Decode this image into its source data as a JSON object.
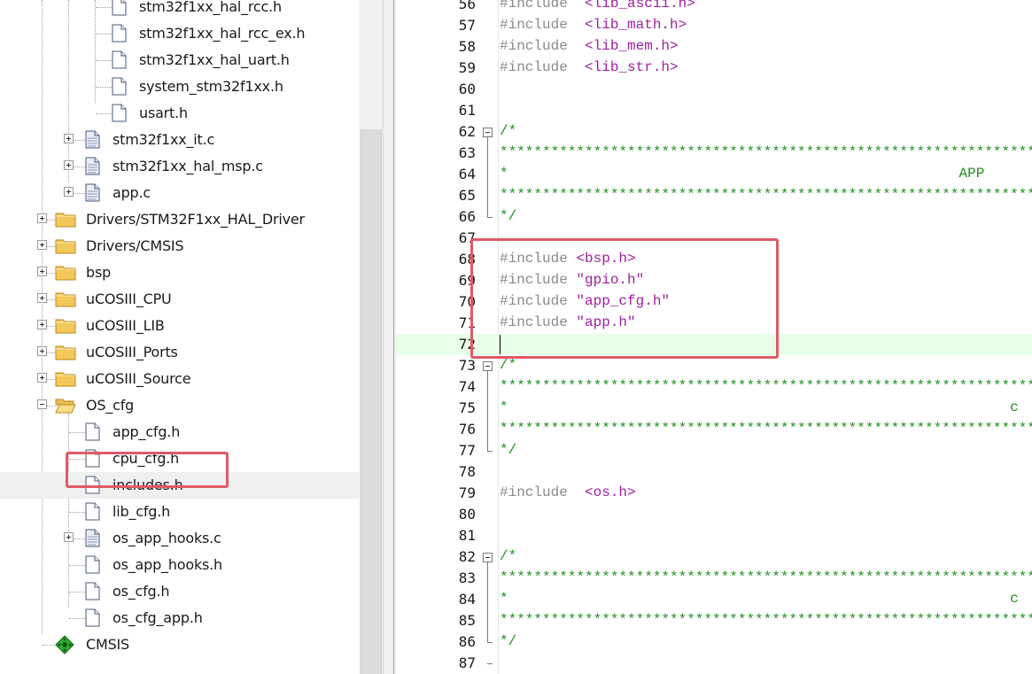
{
  "tree": {
    "items": [
      {
        "label": "stm32f1xx_hal_rcc.h",
        "kind": "h",
        "level": 3
      },
      {
        "label": "stm32f1xx_hal_rcc_ex.h",
        "kind": "h",
        "level": 3
      },
      {
        "label": "stm32f1xx_hal_uart.h",
        "kind": "h",
        "level": 3
      },
      {
        "label": "system_stm32f1xx.h",
        "kind": "h",
        "level": 3
      },
      {
        "label": "usart.h",
        "kind": "h",
        "level": 3
      },
      {
        "label": "stm32f1xx_it.c",
        "kind": "c",
        "level": 2,
        "expand": "plus"
      },
      {
        "label": "stm32f1xx_hal_msp.c",
        "kind": "c",
        "level": 2,
        "expand": "plus"
      },
      {
        "label": "app.c",
        "kind": "c",
        "level": 2,
        "expand": "plus"
      },
      {
        "label": "Drivers/STM32F1xx_HAL_Driver",
        "kind": "folder",
        "level": 1,
        "expand": "plus"
      },
      {
        "label": "Drivers/CMSIS",
        "kind": "folder",
        "level": 1,
        "expand": "plus"
      },
      {
        "label": "bsp",
        "kind": "folder",
        "level": 1,
        "expand": "plus"
      },
      {
        "label": "uCOSIII_CPU",
        "kind": "folder",
        "level": 1,
        "expand": "plus"
      },
      {
        "label": "uCOSIII_LIB",
        "kind": "folder",
        "level": 1,
        "expand": "plus"
      },
      {
        "label": "uCOSIII_Ports",
        "kind": "folder",
        "level": 1,
        "expand": "plus"
      },
      {
        "label": "uCOSIII_Source",
        "kind": "folder",
        "level": 1,
        "expand": "plus"
      },
      {
        "label": "OS_cfg",
        "kind": "folder-open",
        "level": 1,
        "expand": "minus"
      },
      {
        "label": "app_cfg.h",
        "kind": "h",
        "level": 2
      },
      {
        "label": "cpu_cfg.h",
        "kind": "h",
        "level": 2
      },
      {
        "label": "includes.h",
        "kind": "h",
        "level": 2,
        "selected": true
      },
      {
        "label": "lib_cfg.h",
        "kind": "h",
        "level": 2
      },
      {
        "label": "os_app_hooks.c",
        "kind": "c",
        "level": 2,
        "expand": "plus"
      },
      {
        "label": "os_app_hooks.h",
        "kind": "h",
        "level": 2
      },
      {
        "label": "os_cfg.h",
        "kind": "h",
        "level": 2
      },
      {
        "label": "os_cfg_app.h",
        "kind": "h",
        "level": 2
      },
      {
        "label": "CMSIS",
        "kind": "cmsis",
        "level": 1
      }
    ]
  },
  "editor": {
    "lines": [
      {
        "n": "56",
        "code": [
          [
            "pp",
            "#include  "
          ],
          [
            "hdr",
            "<lib_ascii.h>"
          ]
        ]
      },
      {
        "n": "57",
        "code": [
          [
            "pp",
            "#include  "
          ],
          [
            "hdr",
            "<lib_math.h>"
          ]
        ]
      },
      {
        "n": "58",
        "code": [
          [
            "pp",
            "#include  "
          ],
          [
            "hdr",
            "<lib_mem.h>"
          ]
        ]
      },
      {
        "n": "59",
        "code": [
          [
            "pp",
            "#include  "
          ],
          [
            "hdr",
            "<lib_str.h>"
          ]
        ]
      },
      {
        "n": "60",
        "code": []
      },
      {
        "n": "61",
        "code": []
      },
      {
        "n": "62",
        "code": [
          [
            "cm",
            "/*"
          ]
        ],
        "fold": "start"
      },
      {
        "n": "63",
        "code": [
          [
            "cm",
            "***************************************************************************"
          ]
        ]
      },
      {
        "n": "64",
        "code": [
          [
            "cm",
            "*                                                     APP"
          ]
        ]
      },
      {
        "n": "65",
        "code": [
          [
            "cm",
            "***************************************************************************"
          ]
        ]
      },
      {
        "n": "66",
        "code": [
          [
            "cm",
            "*/"
          ]
        ],
        "fold": "end"
      },
      {
        "n": "67",
        "code": []
      },
      {
        "n": "68",
        "code": [
          [
            "pp",
            "#include "
          ],
          [
            "hdr",
            "<bsp.h>"
          ]
        ]
      },
      {
        "n": "69",
        "code": [
          [
            "pp",
            "#include "
          ],
          [
            "hdr",
            "\"gpio.h\""
          ]
        ]
      },
      {
        "n": "70",
        "code": [
          [
            "pp",
            "#include "
          ],
          [
            "hdr",
            "\"app_cfg.h\""
          ]
        ]
      },
      {
        "n": "71",
        "code": [
          [
            "pp",
            "#include "
          ],
          [
            "hdr",
            "\"app.h\""
          ]
        ]
      },
      {
        "n": "72",
        "code": [],
        "current": true
      },
      {
        "n": "73",
        "code": [
          [
            "cm",
            "/*"
          ]
        ],
        "fold": "start"
      },
      {
        "n": "74",
        "code": [
          [
            "cm",
            "***************************************************************************"
          ]
        ]
      },
      {
        "n": "75",
        "code": [
          [
            "cm",
            "*                                                           c"
          ]
        ]
      },
      {
        "n": "76",
        "code": [
          [
            "cm",
            "***************************************************************************"
          ]
        ]
      },
      {
        "n": "77",
        "code": [
          [
            "cm",
            "*/"
          ]
        ],
        "fold": "end"
      },
      {
        "n": "78",
        "code": []
      },
      {
        "n": "79",
        "code": [
          [
            "pp",
            "#include  "
          ],
          [
            "hdr",
            "<os.h>"
          ]
        ]
      },
      {
        "n": "80",
        "code": []
      },
      {
        "n": "81",
        "code": []
      },
      {
        "n": "82",
        "code": [
          [
            "cm",
            "/*"
          ]
        ],
        "fold": "start"
      },
      {
        "n": "83",
        "code": [
          [
            "cm",
            "***************************************************************************"
          ]
        ]
      },
      {
        "n": "84",
        "code": [
          [
            "cm",
            "*                                                           c"
          ]
        ]
      },
      {
        "n": "85",
        "code": [
          [
            "cm",
            "***************************************************************************"
          ]
        ]
      },
      {
        "n": "86",
        "code": [
          [
            "cm",
            "*/"
          ]
        ],
        "fold": "end"
      },
      {
        "n": "87",
        "code": []
      }
    ]
  },
  "colors": {
    "highlight_box": "#e05a66",
    "current_line": "#e8ffe8",
    "preprocessor": "#8a8a8a",
    "header_string": "#a020a0",
    "comment": "#1f8f1f"
  }
}
